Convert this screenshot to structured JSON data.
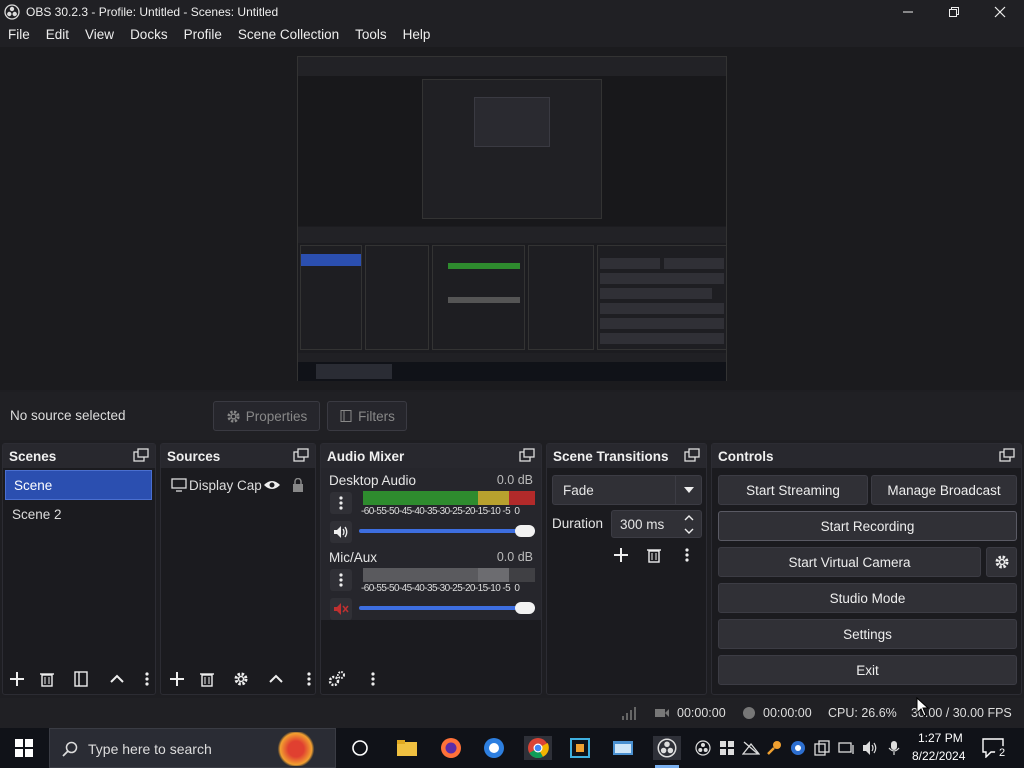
{
  "window": {
    "title": "OBS 30.2.3 - Profile: Untitled - Scenes: Untitled"
  },
  "menu": [
    "File",
    "Edit",
    "View",
    "Docks",
    "Profile",
    "Scene Collection",
    "Tools",
    "Help"
  ],
  "source_toolbar": {
    "no_source": "No source selected",
    "properties": "Properties",
    "filters": "Filters"
  },
  "scenes": {
    "title": "Scenes",
    "items": [
      "Scene",
      "Scene 2"
    ]
  },
  "sources": {
    "title": "Sources",
    "items": [
      "Display Cap"
    ]
  },
  "mixer": {
    "title": "Audio Mixer",
    "channels": [
      {
        "name": "Desktop Audio",
        "level": "0.0 dB",
        "ticks": "-60-55-50-45-40-35-30-25-20-15-10 -5  0",
        "volume": 0.85,
        "muted": false
      },
      {
        "name": "Mic/Aux",
        "level": "0.0 dB",
        "ticks": "-60-55-50-45-40-35-30-25-20-15-10 -5  0",
        "volume": 0.85,
        "muted": true
      }
    ]
  },
  "transitions": {
    "title": "Scene Transitions",
    "selected": "Fade",
    "duration_label": "Duration",
    "duration_value": "300 ms"
  },
  "controls": {
    "title": "Controls",
    "start_streaming": "Start Streaming",
    "manage_broadcast": "Manage Broadcast",
    "start_recording": "Start Recording",
    "start_virtual_camera": "Start Virtual Camera",
    "studio_mode": "Studio Mode",
    "settings": "Settings",
    "exit": "Exit"
  },
  "status": {
    "stream_time": "00:00:00",
    "record_time": "00:00:00",
    "cpu": "CPU: 26.6%",
    "fps": "30.00 / 30.00 FPS"
  },
  "taskbar": {
    "search_placeholder": "Type here to search",
    "time": "1:27 PM",
    "date": "8/22/2024",
    "notifications": "2"
  },
  "colors": {
    "accent": "#2b4fb0",
    "slider": "#3d6ee0",
    "meter_green": "#2e8b2e",
    "meter_yellow": "#b8a12e",
    "meter_red": "#b22a2a"
  }
}
